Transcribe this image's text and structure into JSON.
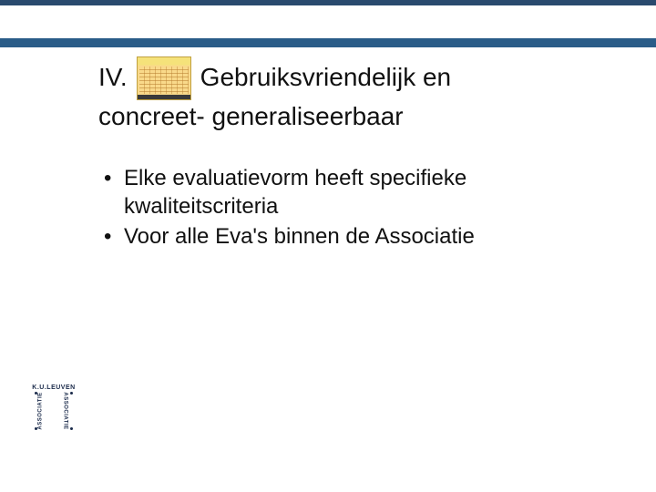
{
  "title": {
    "numeral": "IV.",
    "line1": "Gebruiksvriendelijk en",
    "line2": "concreet- generaliseerbaar"
  },
  "bullets": [
    "Elke evaluatievorm heeft specifieke kwaliteitscriteria",
    "Voor alle Eva's binnen de Associatie"
  ],
  "logo": {
    "top": "K.U.LEUVEN",
    "left": "ASSOCIATIE",
    "right": "ASSOCIATIE",
    "bottom": ""
  }
}
